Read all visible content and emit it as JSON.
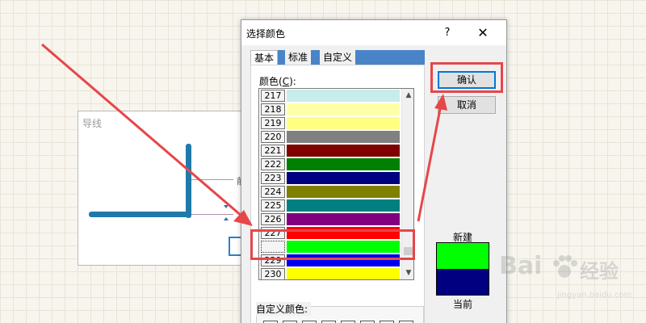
{
  "background_window": {
    "title": "导线",
    "glyph_label": "前"
  },
  "dialog": {
    "title": "选择颜色",
    "help_label": "?",
    "close_label": "✕",
    "tabs": [
      {
        "label": "基本",
        "active": true
      },
      {
        "label": "标准",
        "active": false
      },
      {
        "label": "自定义",
        "active": false
      }
    ],
    "colors_label": "颜色(",
    "colors_accel": "C",
    "colors_label_end": "):",
    "color_rows": [
      {
        "index": "217",
        "color": "#c8ecec"
      },
      {
        "index": "218",
        "color": "#ffffa8"
      },
      {
        "index": "219",
        "color": "#ffff80"
      },
      {
        "index": "220",
        "color": "#808080"
      },
      {
        "index": "221",
        "color": "#800000"
      },
      {
        "index": "222",
        "color": "#008000"
      },
      {
        "index": "223",
        "color": "#000080"
      },
      {
        "index": "224",
        "color": "#808000"
      },
      {
        "index": "225",
        "color": "#008080"
      },
      {
        "index": "226",
        "color": "#800080"
      },
      {
        "index": "227",
        "color": "#ff0000"
      },
      {
        "index": "228",
        "color": "#00ff00"
      },
      {
        "index": "229",
        "color": "#0000ff"
      },
      {
        "index": "230",
        "color": "#ffff00"
      }
    ],
    "selected_index": "228",
    "custom_colors_label": "自定义颜色:",
    "ok_label": "确认",
    "cancel_label": "取消",
    "new_label": "新建",
    "current_label": "当前",
    "new_color": "#00ff00",
    "current_color": "#000080"
  },
  "annotation_color": "#e6464a",
  "watermark": {
    "brand_a": "Bai",
    "brand_b": "经验",
    "url": "jingyan.baidu.com"
  }
}
